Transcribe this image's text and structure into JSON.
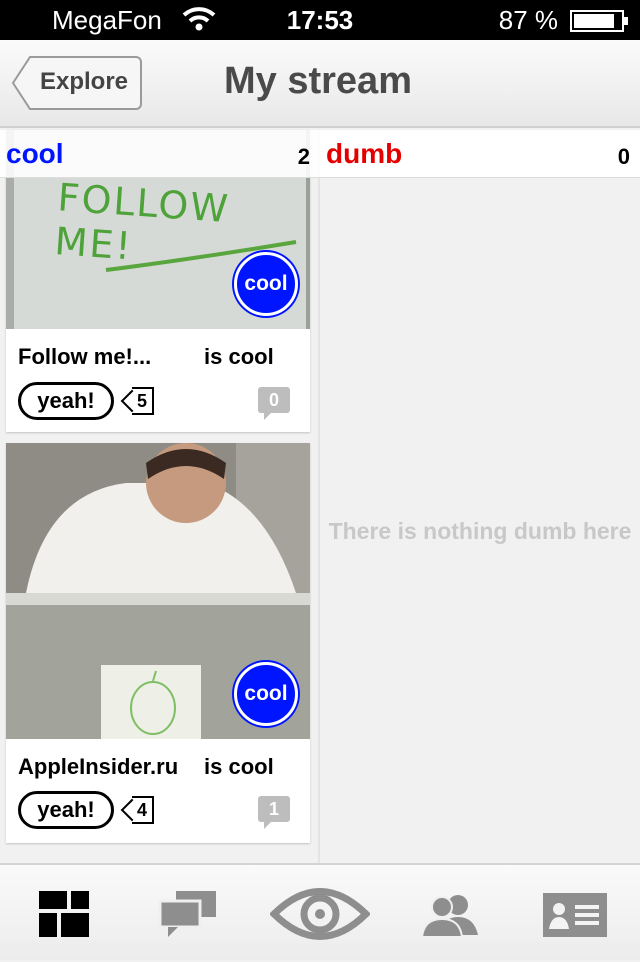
{
  "status": {
    "carrier": "MegaFon",
    "time": "17:53",
    "battery": "87 %",
    "battery_level": 0.87
  },
  "nav": {
    "back_label": "Explore",
    "title": "My stream"
  },
  "columns": {
    "cool": {
      "label": "cool",
      "count": "2",
      "color": "#0015ff"
    },
    "dumb": {
      "label": "dumb",
      "count": "0",
      "color": "#e40000",
      "empty_message": "There is nothing dumb here"
    }
  },
  "cards": [
    {
      "title": "Follow me!...",
      "suffix": "is cool",
      "badge": "cool",
      "yeah_label": "yeah!",
      "yeah_count": "5",
      "comments": "0",
      "photo_text": "FOLLOW ME!"
    },
    {
      "title": "AppleInsider.ru",
      "suffix": "is cool",
      "badge": "cool",
      "yeah_label": "yeah!",
      "yeah_count": "4",
      "comments": "1"
    }
  ],
  "tabbar": {
    "items": [
      {
        "name": "stream",
        "icon": "dashboard-grid-icon",
        "active": true
      },
      {
        "name": "comments",
        "icon": "speech-bubbles-icon",
        "active": false
      },
      {
        "name": "camera",
        "icon": "eye-icon",
        "active": false
      },
      {
        "name": "friends",
        "icon": "people-icon",
        "active": false
      },
      {
        "name": "profile",
        "icon": "profile-card-icon",
        "active": false
      }
    ]
  }
}
